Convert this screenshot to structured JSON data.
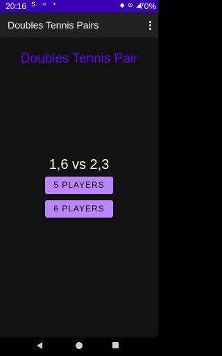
{
  "status_bar": {
    "time": "20:16",
    "left_icons": "S ≈ •",
    "right_icons": "◆ ⊘ ◢",
    "battery": "70%"
  },
  "app_bar": {
    "title": "Doubles Tennis Pairs",
    "overflow_icon": "more-vert-icon"
  },
  "main": {
    "heading": "Doubles Tennis Pair",
    "result": "1,6 vs 2,3",
    "button_5": "5 PLAYERS",
    "button_6": "6 PLAYERS"
  },
  "nav_bar": {
    "back_icon": "back-icon",
    "home_icon": "home-icon",
    "recents_icon": "recents-icon"
  },
  "colors": {
    "status_bar": "#3700b3",
    "app_bar": "#212121",
    "background": "#121212",
    "heading": "#6200ee",
    "button": "#bb86fc"
  }
}
